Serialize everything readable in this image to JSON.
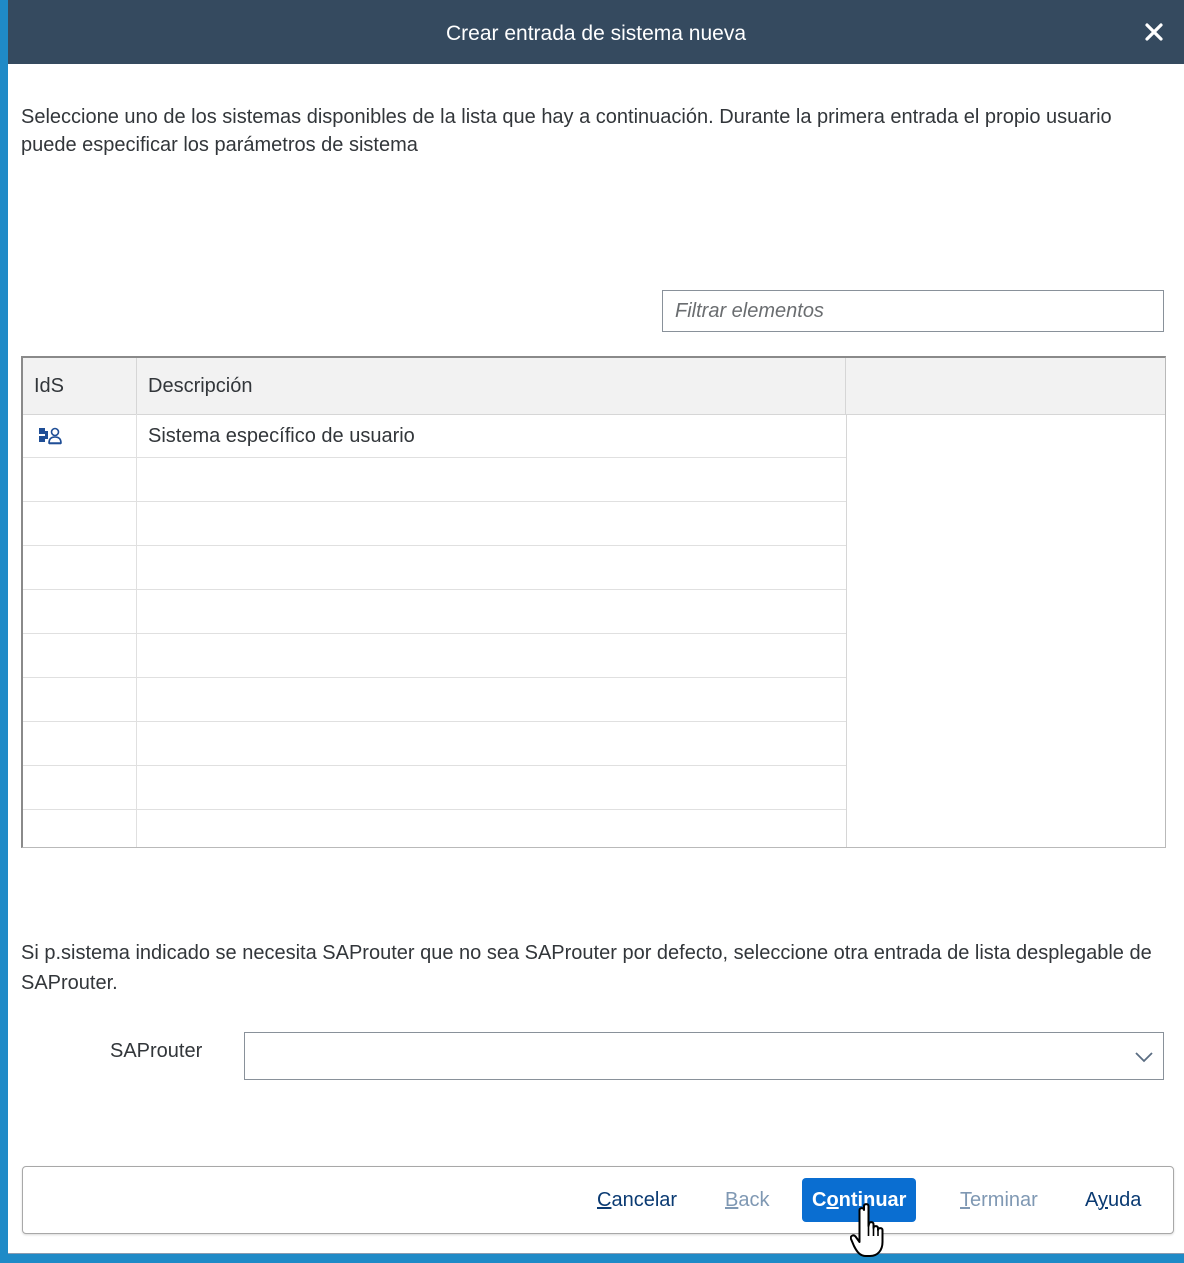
{
  "dialog": {
    "title": "Crear entrada de sistema nueva",
    "close_icon": "close-icon"
  },
  "intro_text": "Seleccione uno de los sistemas disponibles de la lista que hay a continuación. Durante la primera entrada el propio usuario puede especificar los parámetros de sistema",
  "filter": {
    "placeholder": "Filtrar elementos",
    "value": ""
  },
  "table": {
    "columns": [
      "IdS",
      "Descripción",
      ""
    ],
    "rows": [
      {
        "ids_icon": "user-system-icon",
        "description": "Sistema específico de usuario"
      },
      {
        "ids_icon": "",
        "description": ""
      },
      {
        "ids_icon": "",
        "description": ""
      },
      {
        "ids_icon": "",
        "description": ""
      },
      {
        "ids_icon": "",
        "description": ""
      },
      {
        "ids_icon": "",
        "description": ""
      },
      {
        "ids_icon": "",
        "description": ""
      },
      {
        "ids_icon": "",
        "description": ""
      },
      {
        "ids_icon": "",
        "description": ""
      },
      {
        "ids_icon": "",
        "description": ""
      }
    ]
  },
  "router": {
    "note": "Si p.sistema indicado se necesita SAProuter que no sea SAProuter por defecto, seleccione otra entrada de lista desplegable de SAProuter.",
    "label": "SAProuter",
    "selected_value": ""
  },
  "footer": {
    "cancel": {
      "prefix": "",
      "key": "C",
      "suffix": "ancelar"
    },
    "back": {
      "prefix": "",
      "key": "B",
      "suffix": "ack"
    },
    "continue": {
      "prefix": "C",
      "key": "o",
      "suffix": "ntinuar"
    },
    "finish": {
      "prefix": "",
      "key": "T",
      "suffix": "erminar"
    },
    "help": {
      "prefix": "A",
      "key": "y",
      "suffix": "uda"
    }
  },
  "colors": {
    "titlebar": "#354a5f",
    "primary": "#0a6ed1",
    "link": "#0a3a72",
    "disabled": "#7f98b3"
  }
}
